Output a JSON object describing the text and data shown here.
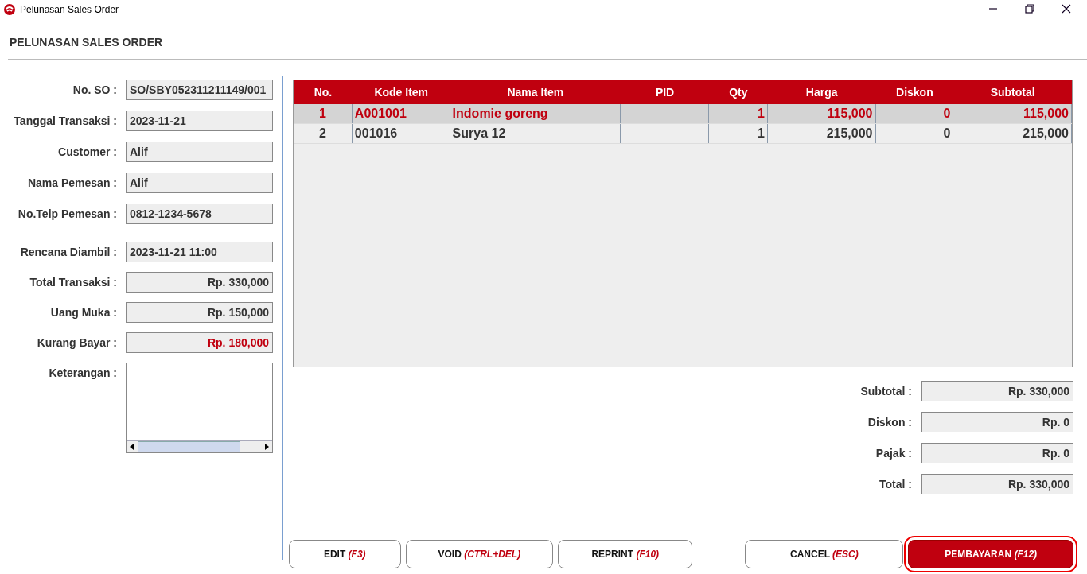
{
  "window": {
    "title": "Pelunasan Sales Order"
  },
  "heading": "PELUNASAN SALES ORDER",
  "order_fields": [
    {
      "label": "No. SO :",
      "value": "SO/SBY052311211149/001",
      "kind": "text"
    },
    {
      "label": "Tanggal Transaksi :",
      "value": "2023-11-21",
      "kind": "text"
    },
    {
      "label": "Customer :",
      "value": "Alif",
      "kind": "text"
    },
    {
      "label": "Nama Pemesan :",
      "value": "Alif",
      "kind": "text"
    },
    {
      "label": "No.Telp Pemesan :",
      "value": "0812-1234-5678",
      "kind": "text"
    }
  ],
  "payment_fields": [
    {
      "label": "Rencana Diambil :",
      "value": "2023-11-21 11:00",
      "kind": "text"
    },
    {
      "label": "Total Transaksi :",
      "value": "Rp. 330,000",
      "kind": "amount"
    },
    {
      "label": "Uang Muka :",
      "value": "Rp. 150,000",
      "kind": "amount"
    },
    {
      "label": "Kurang Bayar :",
      "value": "Rp. 180,000",
      "kind": "due"
    },
    {
      "label": "Keterangan :",
      "kind": "textarea"
    }
  ],
  "table": {
    "columns": [
      "No.",
      "Kode Item",
      "Nama Item",
      "PID",
      "Qty",
      "Harga",
      "Diskon",
      "Subtotal"
    ],
    "rows": [
      {
        "selected": true,
        "cells": [
          "1",
          "A001001",
          "Indomie goreng",
          "",
          "1",
          "115,000",
          "0",
          "115,000"
        ]
      },
      {
        "selected": false,
        "cells": [
          "2",
          "001016",
          "Surya 12",
          "",
          "1",
          "215,000",
          "0",
          "215,000"
        ]
      }
    ]
  },
  "totals": [
    {
      "label": "Subtotal :",
      "value": "Rp. 330,000"
    },
    {
      "label": "Diskon :",
      "value": "Rp. 0"
    },
    {
      "label": "Pajak :",
      "value": "Rp. 0"
    },
    {
      "label": "Total :",
      "value": "Rp. 330,000"
    }
  ],
  "buttons": [
    {
      "label": "EDIT",
      "shortcut": "(F3)",
      "kind": "default",
      "focused": false
    },
    {
      "label": "VOID",
      "shortcut": "(CTRL+DEL)",
      "kind": "default",
      "focused": false
    },
    {
      "label": "REPRINT",
      "shortcut": "(F10)",
      "kind": "default",
      "focused": false
    },
    {
      "label": "CANCEL",
      "shortcut": "(ESC)",
      "kind": "default",
      "focused": false
    },
    {
      "label": "PEMBAYARAN",
      "shortcut": "(F12)",
      "kind": "primary",
      "focused": true
    }
  ]
}
